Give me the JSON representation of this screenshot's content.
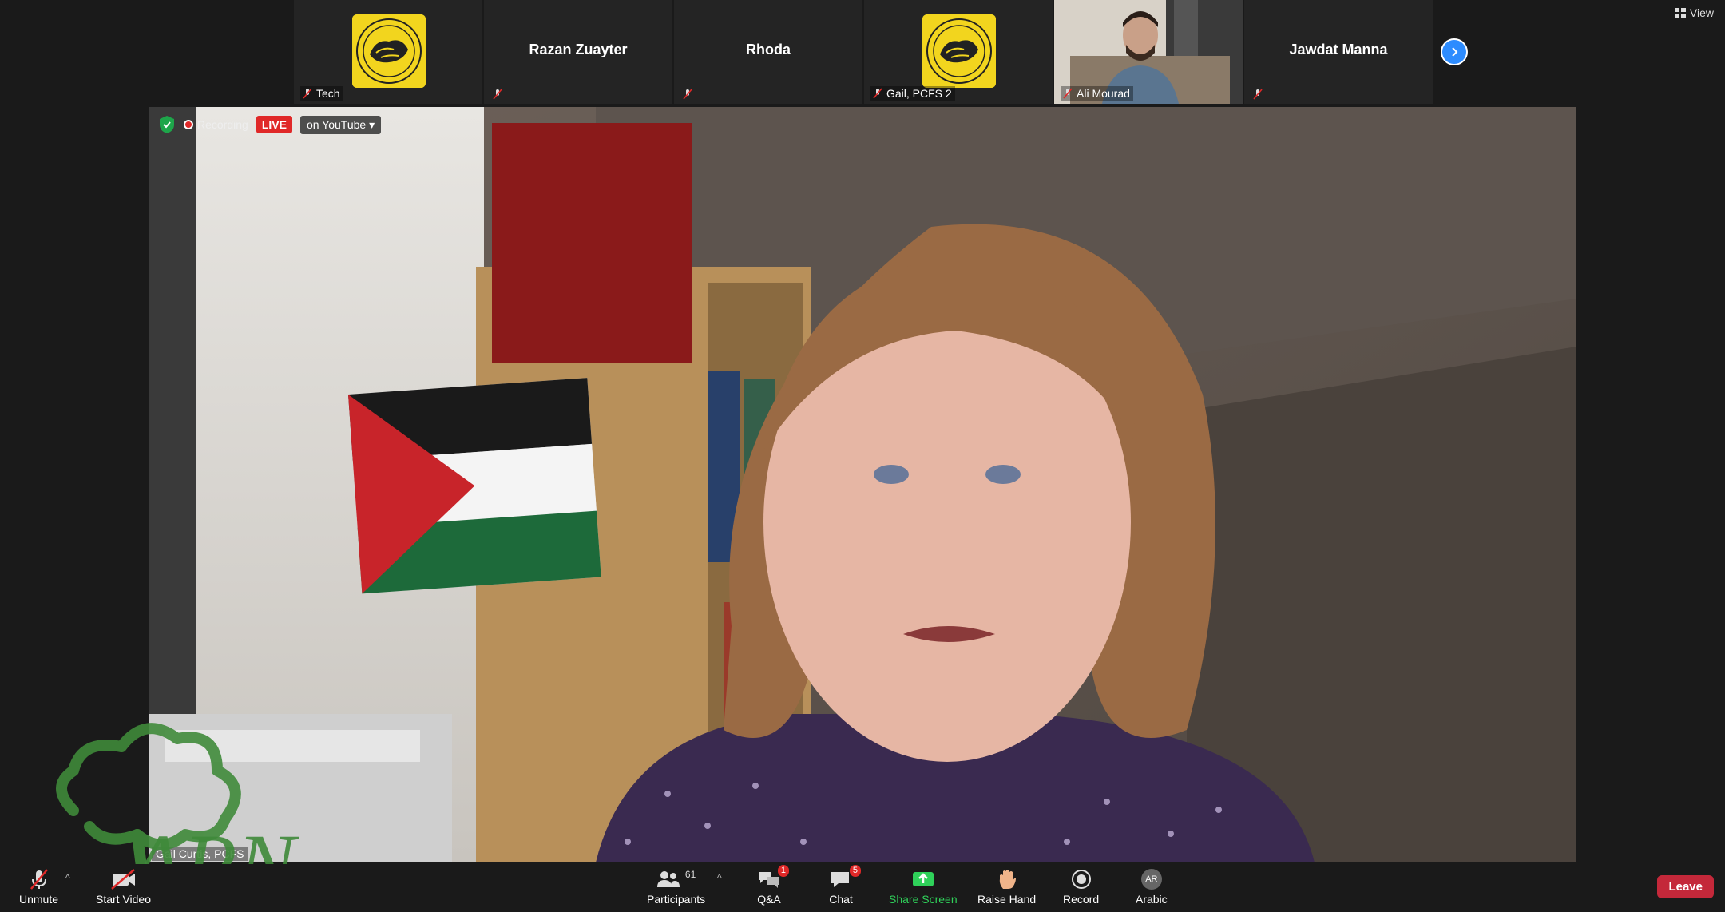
{
  "participants": [
    {
      "label": "Tech",
      "display": "seal"
    },
    {
      "center_name": "Razan Zuayter",
      "display": "name"
    },
    {
      "center_name": "Rhoda",
      "display": "name"
    },
    {
      "label": "Gail, PCFS 2",
      "display": "seal"
    },
    {
      "label": "Ali Mourad",
      "display": "video"
    },
    {
      "center_name": "Jawdat Manna",
      "display": "name"
    }
  ],
  "view_label": "View",
  "recording": {
    "label": "Recording",
    "live": "LIVE",
    "platform": "on YouTube"
  },
  "speaker_label": "Gail Curtis, PCFS",
  "toolbar": {
    "unmute": "Unmute",
    "start_video": "Start Video",
    "participants": "Participants",
    "participants_count": "61",
    "qa": "Q&A",
    "qa_badge": "1",
    "chat": "Chat",
    "chat_badge": "5",
    "share_screen": "Share Screen",
    "raise_hand": "Raise Hand",
    "record": "Record",
    "language": "Arabic",
    "language_avatar": "AR",
    "leave": "Leave"
  },
  "colors": {
    "accent": "#2d8cff",
    "live": "#e02828",
    "share": "#2fd15a",
    "leave": "#c4283a",
    "logo": "#3f8a3a"
  }
}
